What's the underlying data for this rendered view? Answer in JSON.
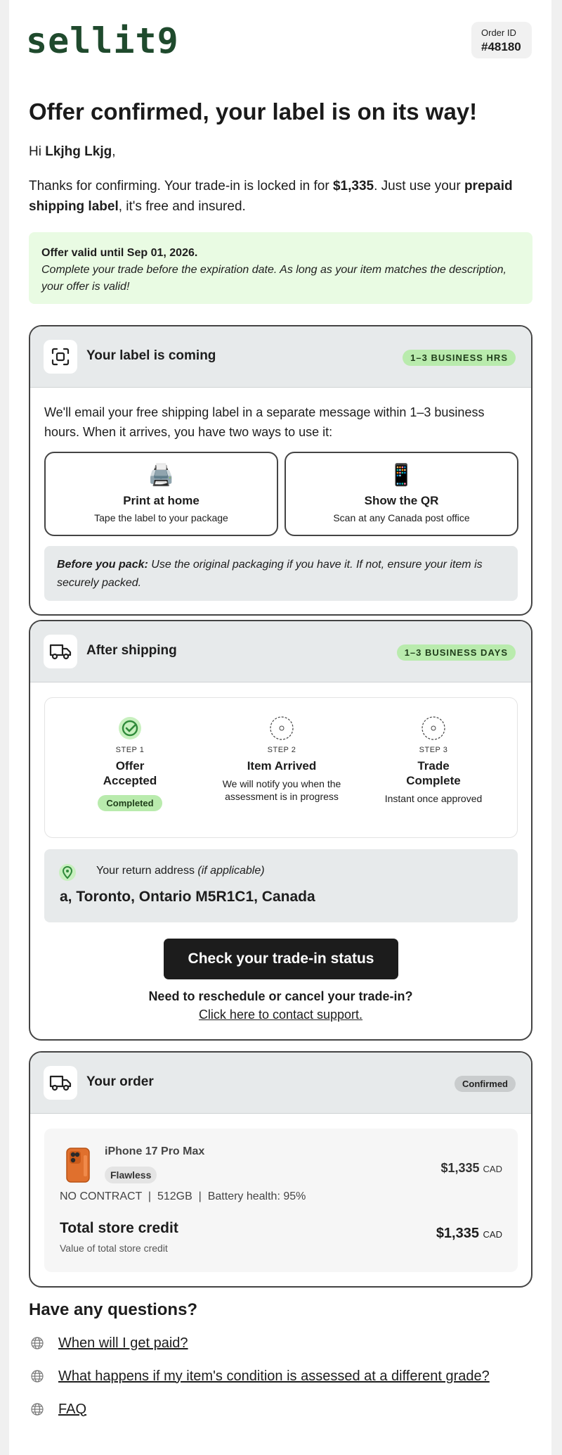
{
  "header": {
    "logo": "sellit9",
    "order_id_label": "Order ID",
    "order_id": "#48180"
  },
  "hero": {
    "title": "Offer confirmed, your label is on its way!",
    "greeting_prefix": "Hi ",
    "customer_name": "Lkjhg Lkjg",
    "greeting_suffix": ",",
    "intro_a": "Thanks for confirming. Your trade-in is locked in for ",
    "intro_amount": "$1,335",
    "intro_b": ". Just use your ",
    "intro_bold": "prepaid shipping label",
    "intro_c": ", it's free and insured."
  },
  "offer": {
    "title": "Offer valid until Sep 01, 2026.",
    "desc": "Complete your trade before the expiration date. As long as your item matches the description, your offer is valid!"
  },
  "label_card": {
    "title": "Your label is coming",
    "badge": "1–3 BUSINESS HRS",
    "text": "We'll email your free shipping label in a separate message within 1–3 business hours. When it arrives, you have two ways to use it:",
    "options": [
      {
        "emoji": "🖨️",
        "title": "Print at home",
        "sub": "Tape the label to your package"
      },
      {
        "emoji": "📱",
        "title": "Show the QR",
        "sub": "Scan at any Canada post office"
      }
    ],
    "pack_bold": "Before you pack:",
    "pack_text": " Use the original packaging if you have it. If not, ensure your item is securely packed."
  },
  "shipping_card": {
    "title": "After shipping",
    "badge": "1–3 BUSINESS DAYS",
    "steps": [
      {
        "num": "STEP 1",
        "title": "Offer Accepted",
        "chip": "Completed",
        "desc": ""
      },
      {
        "num": "STEP 2",
        "title": "Item Arrived",
        "chip": "",
        "desc": "We will notify you when the assessment is in progress"
      },
      {
        "num": "STEP 3",
        "title": "Trade Complete",
        "chip": "",
        "desc": "Instant once approved"
      }
    ],
    "address_label": "Your return address ",
    "address_note": "(if applicable)",
    "address": "a, Toronto, Ontario M5R1C1, Canada",
    "cta": "Check your trade-in status",
    "resched": "Need to reschedule or cancel your trade-in?",
    "contact": "Click here to contact support."
  },
  "order_card": {
    "title": "Your order",
    "badge": "Confirmed",
    "item_name": "iPhone 17 Pro Max",
    "grade": "Flawless",
    "price": "$1,335",
    "currency": "CAD",
    "specs": "NO CONTRACT  |  512GB  |  Battery health: 95%",
    "total_label": "Total store credit",
    "total_sub": "Value of total store credit",
    "total": "$1,335",
    "total_currency": "CAD"
  },
  "faq": {
    "title": "Have any questions?",
    "items": [
      "When will I get paid?",
      "What happens if my item's condition is assessed at a different grade?",
      "FAQ"
    ]
  },
  "colors": {
    "brand": "#1f4a2d",
    "accent_green": "#b9ebad",
    "offer_bg": "#e9fbe3",
    "cta_bg": "#1c1c1c"
  }
}
